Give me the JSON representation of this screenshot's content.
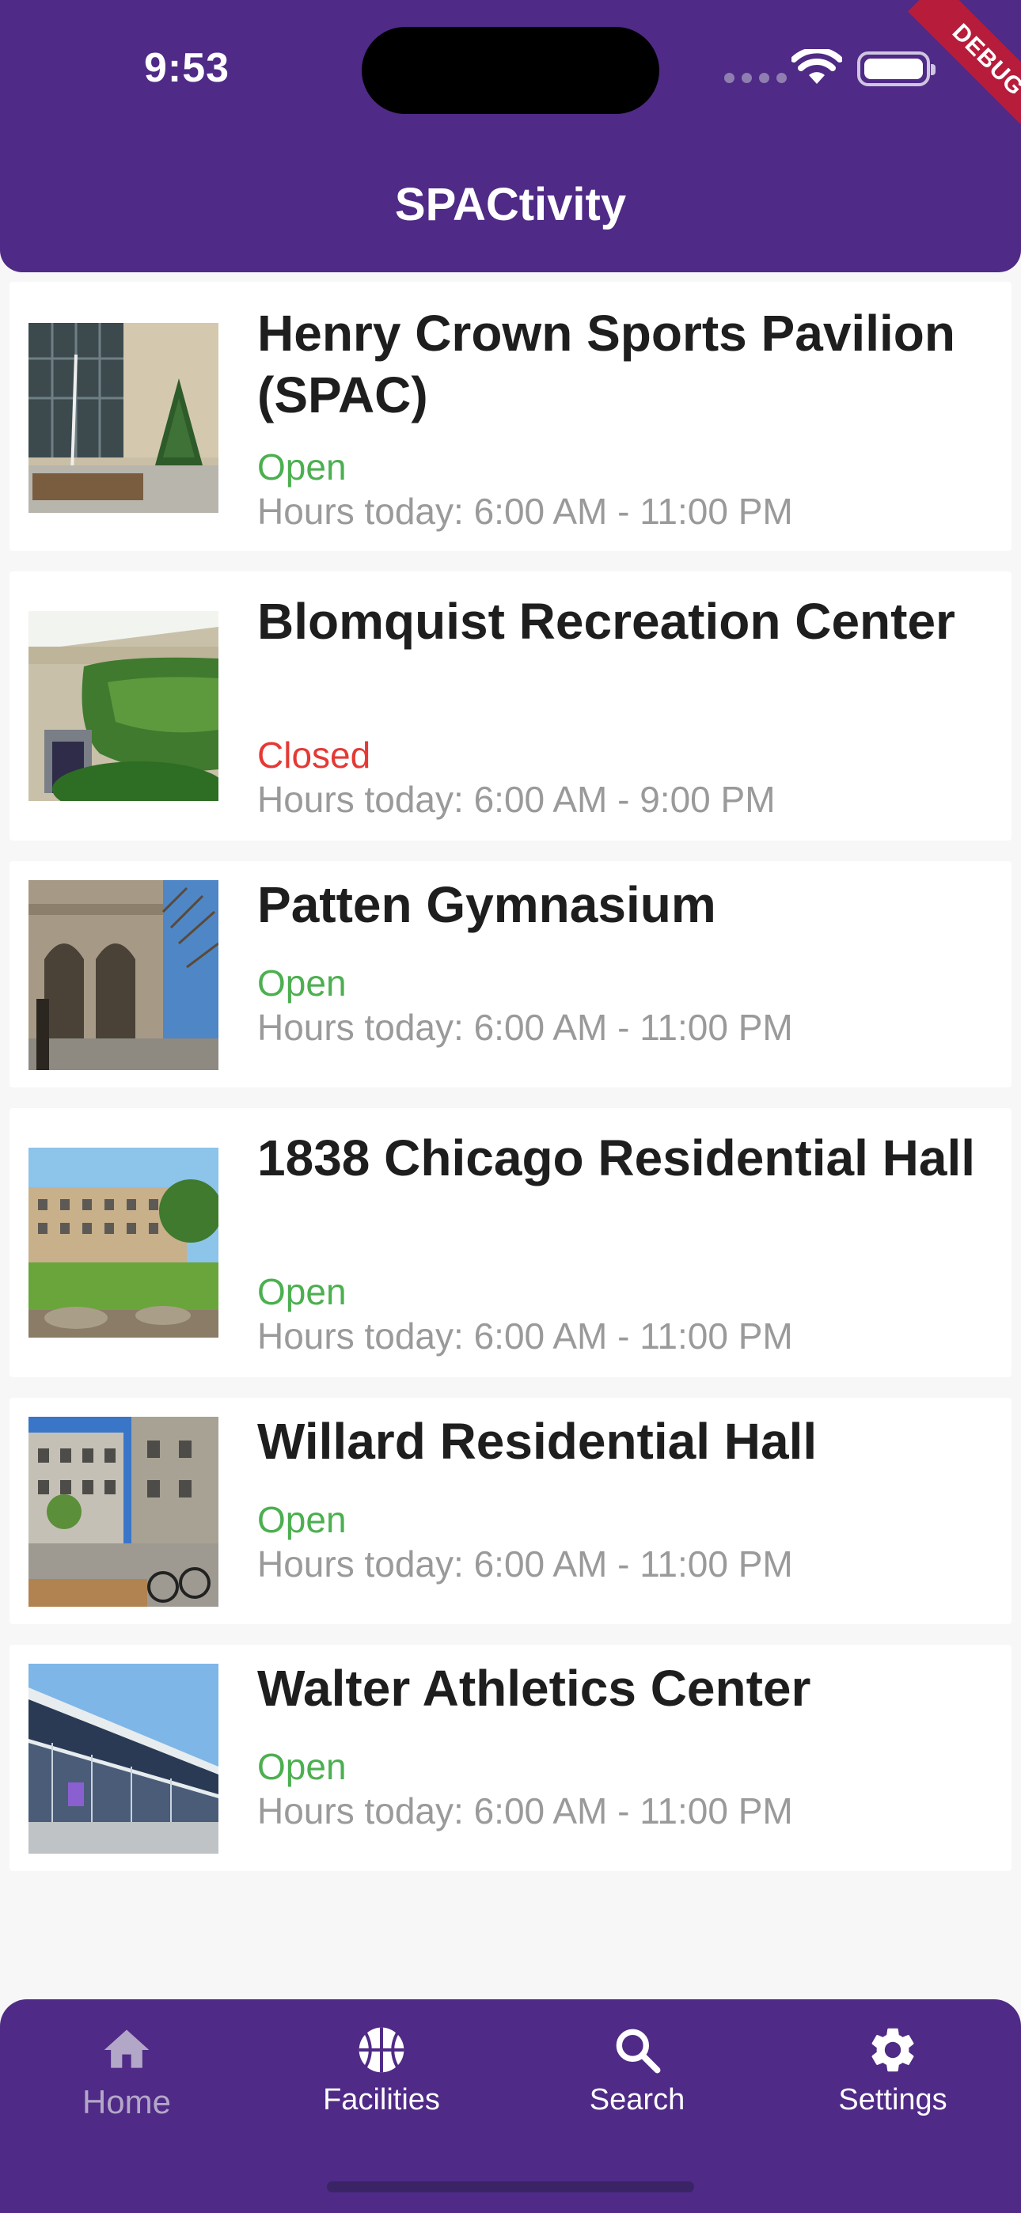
{
  "status_bar": {
    "time": "9:53"
  },
  "debug_banner": "DEBUG",
  "app_title": "SPACtivity",
  "colors": {
    "brand": "#4f2a86",
    "open": "#4caf50",
    "closed": "#e53935",
    "hours": "#9a9a9a"
  },
  "facilities": [
    {
      "name": "Henry Crown Sports Pavilion (SPAC)",
      "status": "Open",
      "hours": "Hours today: 6:00 AM - 11:00 PM"
    },
    {
      "name": "Blomquist Recreation Center",
      "status": "Closed",
      "hours": "Hours today: 6:00 AM - 9:00 PM"
    },
    {
      "name": "Patten Gymnasium",
      "status": "Open",
      "hours": "Hours today: 6:00 AM - 11:00 PM"
    },
    {
      "name": "1838 Chicago Residential Hall",
      "status": "Open",
      "hours": "Hours today: 6:00 AM - 11:00 PM"
    },
    {
      "name": "Willard Residential Hall",
      "status": "Open",
      "hours": "Hours today: 6:00 AM - 11:00 PM"
    },
    {
      "name": "Walter Athletics Center",
      "status": "Open",
      "hours": "Hours today: 6:00 AM - 11:00 PM"
    }
  ],
  "bottom_nav": [
    {
      "label": "Home",
      "icon": "home-icon",
      "active": false
    },
    {
      "label": "Facilities",
      "icon": "basketball-icon",
      "active": true
    },
    {
      "label": "Search",
      "icon": "search-icon",
      "active": true
    },
    {
      "label": "Settings",
      "icon": "gear-icon",
      "active": true
    }
  ]
}
